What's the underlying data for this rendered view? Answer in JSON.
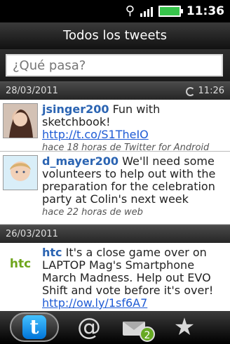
{
  "status": {
    "time": "11:36"
  },
  "title": "Todos los tweets",
  "composer": {
    "placeholder": "¿Qué pasa?"
  },
  "sections": [
    {
      "date": "28/03/2011",
      "refresh_time": "11:26"
    },
    {
      "date": "26/03/2011"
    }
  ],
  "tweets": [
    {
      "user": "jsinger200",
      "text": "Fun with sketchbook!",
      "link": "http://t.co/S1TheIO",
      "meta": "hace 18 horas de Twitter for Android",
      "avatar": "woman-avatar"
    },
    {
      "user": "d_mayer200",
      "text": "We'll need some volunteers to help out with the preparation for the celebration party at Colin's next week",
      "meta": "hace 22 horas de web",
      "avatar": "child-avatar"
    },
    {
      "user": "htc",
      "text": "It's a close game over on LAPTOP Mag's Smartphone March Madness. Help out EVO Shift and vote before it's over!",
      "link": "http://ow.ly/1sf6A7",
      "logo": "htc",
      "avatar": "htc-logo"
    }
  ],
  "bottom_tabs": [
    {
      "name": "twitter-tab",
      "icon": "twitter-bird-icon"
    },
    {
      "name": "mentions-tab",
      "icon": "at-icon",
      "label": "@"
    },
    {
      "name": "messages-tab",
      "icon": "mail-icon",
      "badge": "2"
    },
    {
      "name": "favorites-tab",
      "icon": "star-icon",
      "label": "★"
    }
  ]
}
